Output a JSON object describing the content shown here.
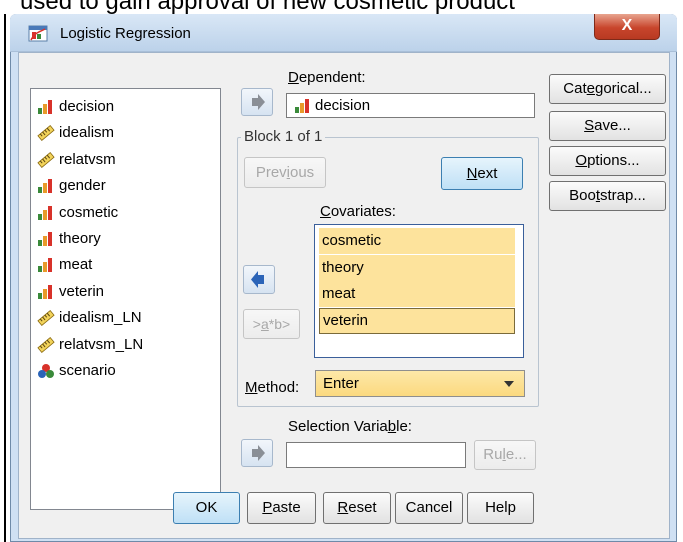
{
  "background_caption": "used to gain approval of new cosmetic product",
  "window": {
    "title": "Logistic Regression",
    "close_glyph": "X"
  },
  "variables": [
    {
      "name": "decision",
      "type": "nominal"
    },
    {
      "name": "idealism",
      "type": "scale"
    },
    {
      "name": "relatvsm",
      "type": "scale"
    },
    {
      "name": "gender",
      "type": "nominal"
    },
    {
      "name": "cosmetic",
      "type": "nominal"
    },
    {
      "name": "theory",
      "type": "nominal"
    },
    {
      "name": "meat",
      "type": "nominal"
    },
    {
      "name": "veterin",
      "type": "nominal"
    },
    {
      "name": "idealism_LN",
      "type": "scale"
    },
    {
      "name": "relatvsm_LN",
      "type": "scale"
    },
    {
      "name": "scenario",
      "type": "set"
    }
  ],
  "dependent": {
    "label_pre": "",
    "label_key": "D",
    "label_post": "ependent:",
    "value": "decision"
  },
  "block": {
    "legend": "Block 1 of 1",
    "previous": {
      "pre": "Prev",
      "key": "i",
      "post": "ous"
    },
    "next": {
      "pre": "",
      "key": "N",
      "post": "ext"
    },
    "covariates_label": {
      "pre": "",
      "key": "C",
      "post": "ovariates:"
    },
    "covariates": [
      "cosmetic",
      "theory",
      "meat",
      "veterin"
    ],
    "interaction": {
      "pre": ">",
      "key": "a",
      "post": "*b>"
    },
    "method": {
      "pre": "",
      "key": "M",
      "post": "ethod:"
    },
    "method_value": "Enter"
  },
  "selection": {
    "label": {
      "pre": "Selection Varia",
      "key": "b",
      "post": "le:"
    },
    "value": "",
    "rule": {
      "pre": "Ru",
      "key": "l",
      "post": "e..."
    }
  },
  "side_buttons": [
    {
      "pre": "Cat",
      "key": "e",
      "post": "gorical..."
    },
    {
      "pre": "",
      "key": "S",
      "post": "ave..."
    },
    {
      "pre": "",
      "key": "O",
      "post": "ptions..."
    },
    {
      "pre": "Boo",
      "key": "t",
      "post": "strap..."
    }
  ],
  "bottom_buttons": [
    {
      "pre": "OK",
      "key": "",
      "post": ""
    },
    {
      "pre": "",
      "key": "P",
      "post": "aste"
    },
    {
      "pre": "",
      "key": "R",
      "post": "eset"
    },
    {
      "pre": "Cancel",
      "key": "",
      "post": ""
    },
    {
      "pre": "Help",
      "key": "",
      "post": ""
    }
  ],
  "colors": {
    "dialog_frame": "#cfe0f3",
    "client": "#f0f0f0",
    "covariate_highlight": "#fde39c",
    "close_button": "#c8452c",
    "default_button_border": "#3c7fb1"
  }
}
